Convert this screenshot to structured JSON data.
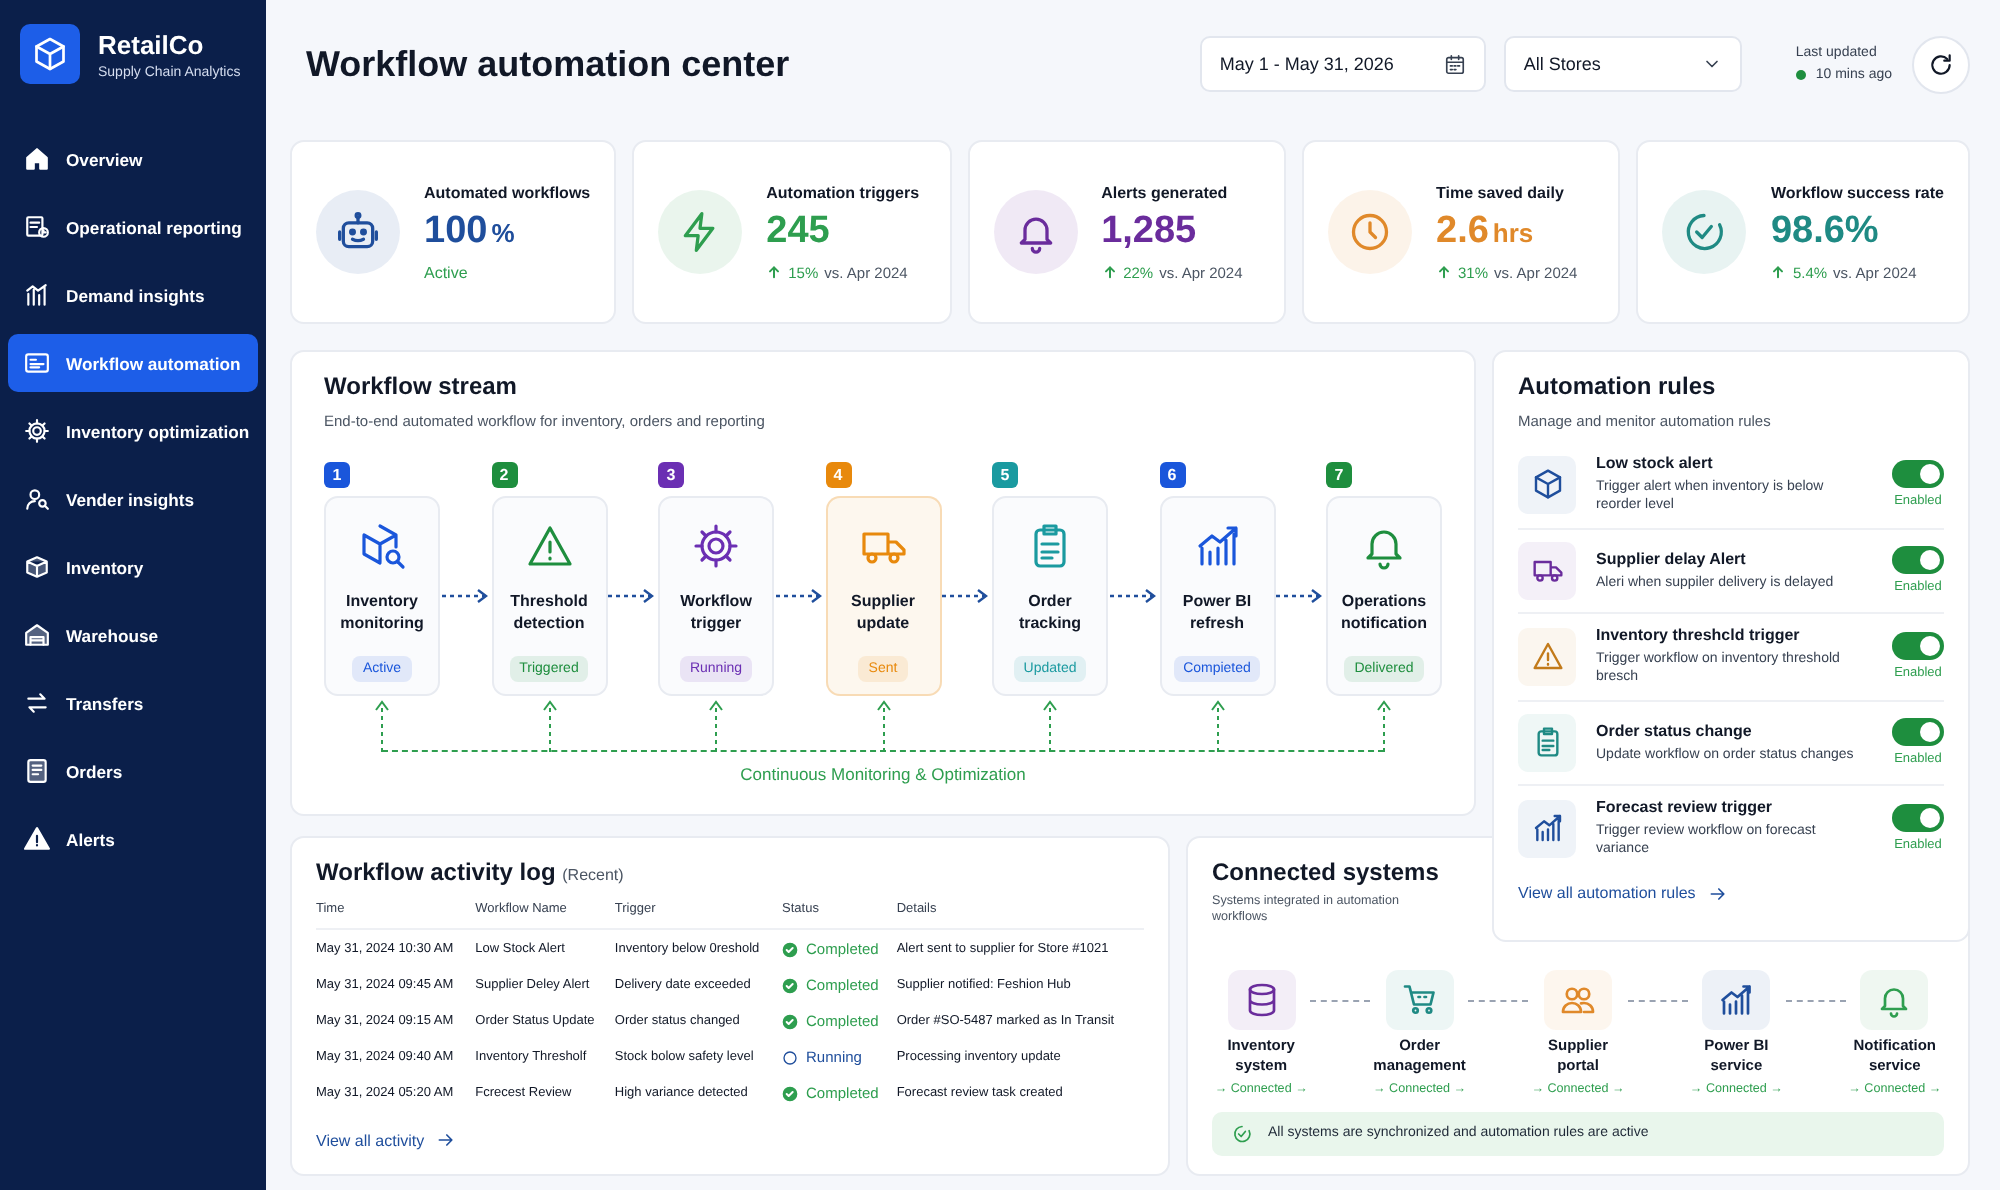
{
  "brand": {
    "name": "RetailCo",
    "tagline": "Supply Chain Analytics"
  },
  "sidebar": {
    "items": [
      {
        "label": "Overview",
        "selected": false
      },
      {
        "label": "Operational reporting",
        "selected": false
      },
      {
        "label": "Demand insights",
        "selected": false
      },
      {
        "label": "Workflow automation",
        "selected": true
      },
      {
        "label": "Inventory optimization",
        "selected": false
      },
      {
        "label": "Vender insights",
        "selected": false
      },
      {
        "label": "Inventory",
        "selected": false
      },
      {
        "label": "Warehouse",
        "selected": false
      },
      {
        "label": "Transfers",
        "selected": false
      },
      {
        "label": "Orders",
        "selected": false
      },
      {
        "label": "Alerts",
        "selected": false
      }
    ]
  },
  "header": {
    "title": "Workflow automation center",
    "date_range": "May 1 - May 31, 2026",
    "store_filter": "All Stores",
    "last_updated_label": "Last updated",
    "last_updated_value": "10 mins ago"
  },
  "kpis": [
    {
      "label": "Automated workflows",
      "value": "100",
      "unit": "%",
      "kind": "status",
      "status": "Active",
      "color": "#1f4e9c"
    },
    {
      "label": "Automation triggers",
      "value": "245",
      "kind": "delta",
      "delta": "15%",
      "compare": "vs. Apr 2024",
      "color": "#2e9e4f"
    },
    {
      "label": "Alerts generated",
      "value": "1,285",
      "kind": "delta",
      "delta": "22%",
      "compare": "vs. Apr 2024",
      "color": "#6a2c9c"
    },
    {
      "label": "Time saved daily",
      "value": "2.6",
      "unit": "hrs",
      "kind": "delta",
      "delta": "31%",
      "compare": "vs. Apr 2024",
      "color": "#e0892a"
    },
    {
      "label": "Workflow success rate",
      "value": "98.6%",
      "kind": "delta",
      "delta": "5.4%",
      "compare": "vs. Apr 2024",
      "color": "#1f8a84"
    }
  ],
  "workflow_stream": {
    "title": "Workflow stream",
    "subtitle": "End-to-end automated workflow for inventory, orders and reporting",
    "loop_label": "Continuous Monitoring & Optimization",
    "steps": [
      {
        "number": "1",
        "label": "Inventory monitoring",
        "status": "Active",
        "color": "#1a56db",
        "selected": false
      },
      {
        "number": "2",
        "label": "Threshold detection",
        "status": "Triggered",
        "color": "#1e8e3e",
        "selected": false
      },
      {
        "number": "3",
        "label": "Workflow trigger",
        "status": "Running",
        "color": "#6b2fb3",
        "selected": false
      },
      {
        "number": "4",
        "label": "Supplier update",
        "status": "Sent",
        "color": "#e8890c",
        "selected": true
      },
      {
        "number": "5",
        "label": "Order tracking",
        "status": "Updated",
        "color": "#1a9aa0",
        "selected": false
      },
      {
        "number": "6",
        "label": "Power BI refresh",
        "status": "Compieted",
        "color": "#1a56db",
        "selected": false
      },
      {
        "number": "7",
        "label": "Operations notification",
        "status": "Delivered",
        "color": "#1e8e3e",
        "selected": false
      }
    ]
  },
  "automation_rules": {
    "title": "Automation rules",
    "subtitle": "Manage and menitor automation rules",
    "link": "View all automation rules",
    "rules": [
      {
        "name": "Low stock alert",
        "description": "Trigger alert when inventory is below reorder level",
        "on": true,
        "status": "Enabled",
        "color": "#1f4e9c"
      },
      {
        "name": "Supplier delay Alert",
        "description": "Aleri when suppiler delivery is delayed",
        "on": true,
        "status": "Enabled",
        "color": "#6a2c9c"
      },
      {
        "name": "Inventory threshcld trigger",
        "description": "Trigger workflow on inventory threshold bresch",
        "on": true,
        "status": "Enabled",
        "color": "#c27a1a"
      },
      {
        "name": "Order status change",
        "description": "Update workflow on order status changes",
        "on": true,
        "status": "Enabled",
        "color": "#1f8a84"
      },
      {
        "name": "Forecast review trigger",
        "description": "Trigger review workflow on forecast variance",
        "on": true,
        "status": "Enabled",
        "color": "#1f4e9c"
      }
    ]
  },
  "activity_log": {
    "title": "Workflow activity log",
    "title_note": "(Recent)",
    "link": "View all activity",
    "columns": [
      "Time",
      "Workflow Name",
      "Trigger",
      "Status",
      "Details"
    ],
    "rows": [
      {
        "time": "May 31, 2024 10:30 AM",
        "name": "Low Stock Alert",
        "trigger": "Inventory below 0reshold",
        "status": "Completed",
        "kind": "completed",
        "details": "Alert sent to supplier for Store #1021"
      },
      {
        "time": "May 31, 2024 09:45 AM",
        "name": "Supplier Deley Alert",
        "trigger": "Delivery date exceeded",
        "status": "Completed",
        "kind": "completed",
        "details": "Supplier notified: Feshion Hub"
      },
      {
        "time": "May 31, 2024 09:15 AM",
        "name": "Order Status Update",
        "trigger": "Order status changed",
        "status": "Completed",
        "kind": "completed",
        "details": "Order #SO-5487 marked as In Transit"
      },
      {
        "time": "May 31, 2024 09:40 AM",
        "name": "Inventory Thresholf",
        "trigger": "Stock bolow safety level",
        "status": "Running",
        "kind": "running",
        "details": "Processing inventory update"
      },
      {
        "time": "May 31, 2024 05:20 AM",
        "name": "Fcrecest Review",
        "trigger": "High variance detected",
        "status": "Completed",
        "kind": "completed",
        "details": "Forecast review task created"
      }
    ]
  },
  "connected_systems": {
    "title": "Connected systems",
    "subtitle": "Systems integrated in automation workflows",
    "banner": "All systems are synchronized and automation rules are active",
    "systems": [
      {
        "name": "Inventory system",
        "status": "→ Connected →",
        "color": "#6a2c9c"
      },
      {
        "name": "Order management",
        "status": "→ Connected →",
        "color": "#1f8a84"
      },
      {
        "name": "Supplier portal",
        "status": "→ Connected →",
        "color": "#e0892a"
      },
      {
        "name": "Power BI service",
        "status": "→ Connected →",
        "color": "#1f4e9c"
      },
      {
        "name": "Notification service",
        "status": "→ Connected →",
        "color": "#2e9e4f"
      }
    ]
  }
}
